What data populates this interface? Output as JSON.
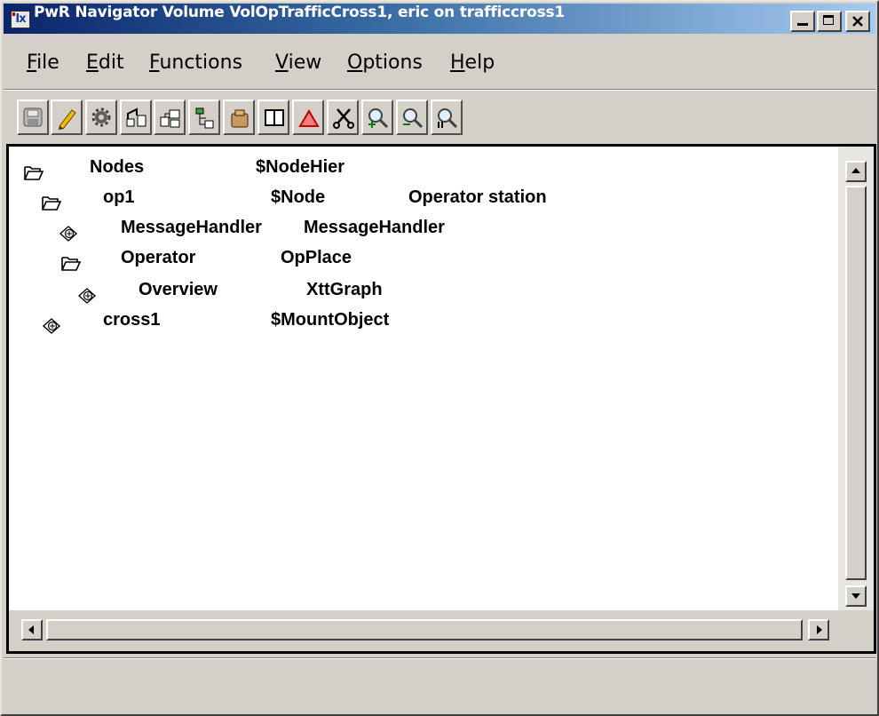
{
  "window": {
    "title": "PwR Navigator Volume VolOpTrafficCross1, eric on trafficcross1",
    "icon_label": "Ix"
  },
  "menu": [
    {
      "label": "File",
      "accel": "F",
      "rest": "ile"
    },
    {
      "label": "Edit",
      "accel": "E",
      "rest": "dit"
    },
    {
      "label": "Functions",
      "accel": "F",
      "rest": "unctions"
    },
    {
      "label": "View",
      "accel": "V",
      "rest": "iew"
    },
    {
      "label": "Options",
      "accel": "O",
      "rest": "ptions"
    },
    {
      "label": "Help",
      "accel": "H",
      "rest": "elp"
    }
  ],
  "toolbar": [
    {
      "icon": "save-icon"
    },
    {
      "icon": "edit-pencil-icon"
    },
    {
      "icon": "build-gear-icon"
    },
    {
      "icon": "distribute-icon"
    },
    {
      "icon": "plc-hierarchy-icon"
    },
    {
      "icon": "node-hierarchy-icon"
    },
    {
      "icon": "object-box-icon"
    },
    {
      "icon": "two-pane-icon"
    },
    {
      "icon": "warning-triangle-icon"
    },
    {
      "icon": "cut-scissors-icon"
    },
    {
      "icon": "zoom-in-icon"
    },
    {
      "icon": "zoom-out-icon"
    },
    {
      "icon": "zoom-reset-icon"
    }
  ],
  "tree": [
    {
      "name": "Nodes",
      "class": "$NodeHier",
      "description": "",
      "icon": "folder-open-icon",
      "depth": 0
    },
    {
      "name": "op1",
      "class": "$Node",
      "description": "Operator station",
      "icon": "folder-open-icon",
      "depth": 1
    },
    {
      "name": "MessageHandler",
      "class": "MessageHandler",
      "description": "",
      "icon": "leaf-object-icon",
      "depth": 2
    },
    {
      "name": "Operator",
      "class": "OpPlace",
      "description": "",
      "icon": "folder-open-icon",
      "depth": 2
    },
    {
      "name": "Overview",
      "class": "XttGraph",
      "description": "",
      "icon": "leaf-object-icon",
      "depth": 3
    },
    {
      "name": "cross1",
      "class": "$MountObject",
      "description": "",
      "icon": "leaf-object-icon",
      "depth": 1
    }
  ],
  "colors": {
    "title_gradient_start": "#0a246a",
    "title_gradient_end": "#a6caf0",
    "chrome": "#d4d0c8",
    "content_bg": "#ffffff"
  }
}
